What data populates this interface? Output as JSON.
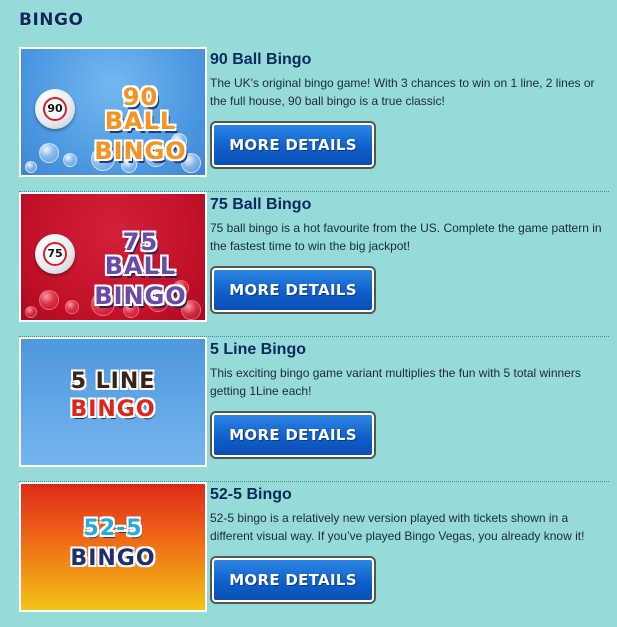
{
  "page": {
    "heading": "BINGO"
  },
  "games": [
    {
      "title": "90 Ball Bingo",
      "description": "The UK's original bingo game! With 3 chances to win on 1 line, 2 lines or the full house, 90 ball bingo is a true classic!",
      "button_label": "MORE DETAILS",
      "logo": {
        "ball_number": "90",
        "line1": "90 BALL",
        "line2": "BINGO"
      }
    },
    {
      "title": "75 Ball Bingo",
      "description": "75 ball bingo is a hot favourite from the US. Complete the game pattern in the fastest time to win the big jackpot!",
      "button_label": "MORE DETAILS",
      "logo": {
        "ball_number": "75",
        "line1": "75 BALL",
        "line2": "BINGO"
      }
    },
    {
      "title": "5 Line Bingo",
      "description": "This exciting bingo game variant multiplies the fun with 5 total winners getting 1Line each!",
      "button_label": "MORE DETAILS",
      "logo": {
        "line1": "5 LINE",
        "line2": "BINGO"
      }
    },
    {
      "title": "52-5 Bingo",
      "description": "52-5 bingo is a relatively new version played with tickets shown in a different visual way. If you’ve played Bingo Vegas, you already know it!",
      "button_label": "MORE DETAILS",
      "logo": {
        "line1": "52-5",
        "line2": "BINGO"
      }
    }
  ],
  "colors": {
    "page_background": "#97dada",
    "heading_text": "#0b2a5e",
    "button_blue": "#0f5fcc",
    "divider": "#3e8f98"
  }
}
